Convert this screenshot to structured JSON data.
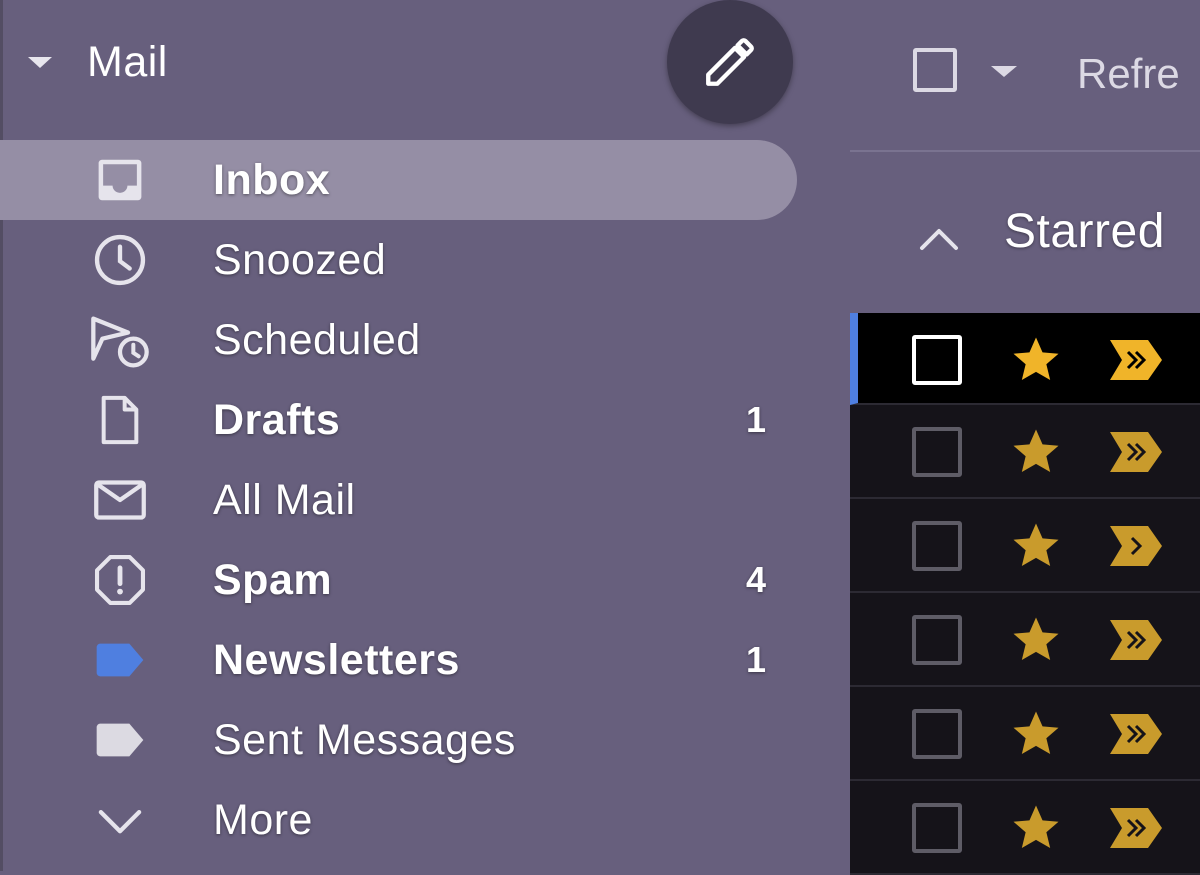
{
  "sidebar": {
    "header": {
      "title": "Mail",
      "collapse_icon": "caret-down-icon"
    },
    "compose": {
      "icon": "pencil-icon"
    },
    "items": [
      {
        "label": "Inbox",
        "icon": "inbox-icon",
        "count": "",
        "bold": true,
        "active": true
      },
      {
        "label": "Snoozed",
        "icon": "clock-icon",
        "count": "",
        "bold": false,
        "active": false
      },
      {
        "label": "Scheduled",
        "icon": "scheduled-send-icon",
        "count": "",
        "bold": false,
        "active": false
      },
      {
        "label": "Drafts",
        "icon": "draft-icon",
        "count": "1",
        "bold": true,
        "active": false
      },
      {
        "label": "All Mail",
        "icon": "envelope-icon",
        "count": "",
        "bold": false,
        "active": false
      },
      {
        "label": "Spam",
        "icon": "spam-icon",
        "count": "4",
        "bold": true,
        "active": false
      },
      {
        "label": "Newsletters",
        "icon": "label-icon",
        "count": "1",
        "bold": true,
        "active": false,
        "color": "#4f7fe0"
      },
      {
        "label": "Sent Messages",
        "icon": "label-icon",
        "count": "",
        "bold": false,
        "active": false,
        "color": "#dcdae2"
      },
      {
        "label": "More",
        "icon": "chevron-down-icon",
        "count": "",
        "bold": false,
        "active": false
      }
    ]
  },
  "toolbar": {
    "refresh_label": "Refre",
    "select_icon": "checkbox-icon",
    "select_menu_icon": "caret-down-icon"
  },
  "section": {
    "title": "Starred",
    "toggle_icon": "chevron-up-icon"
  },
  "messages": [
    {
      "selected": true,
      "starred": true,
      "importance": "double"
    },
    {
      "selected": false,
      "starred": true,
      "importance": "double"
    },
    {
      "selected": false,
      "starred": true,
      "importance": "single"
    },
    {
      "selected": false,
      "starred": true,
      "importance": "double"
    },
    {
      "selected": false,
      "starred": true,
      "importance": "double"
    },
    {
      "selected": false,
      "starred": true,
      "importance": "double"
    }
  ],
  "colors": {
    "sidebar_bg": "#675f7d",
    "active_item_bg": "#958ea5",
    "compose_bg": "#3f3a4f",
    "star_color": "#c99b2c",
    "star_selected_color": "#f0b429",
    "row_bg": "#151319",
    "accent_blue": "#4f7fe0"
  }
}
